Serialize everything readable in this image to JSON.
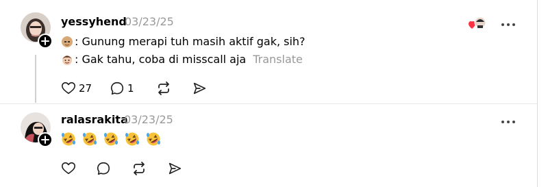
{
  "posts": [
    {
      "username": "yessyhend",
      "date": "03/23/25",
      "lines": [
        {
          "text": ": Gunung merapi tuh masih aktif gak, sih?",
          "emoji": "bald-man-emoji"
        },
        {
          "text": ": Gak tahu, coba di misscall aja",
          "emoji": "smiling-man-emoji"
        }
      ],
      "translate_label": "Translate",
      "like_count": "27",
      "reply_count": "1"
    },
    {
      "username": "ralasrakita",
      "date": "03/23/25",
      "emoji_line": [
        "rofl-emoji",
        "rofl-emoji",
        "rofl-emoji",
        "rofl-emoji",
        "rofl-emoji"
      ]
    }
  ],
  "icons": {
    "like": "heart-icon",
    "reply": "comment-icon",
    "repost": "repost-icon",
    "share": "send-icon",
    "more": "more-icon",
    "follow": "plus-icon"
  },
  "colors": {
    "liked_heart": "#ff3040",
    "muted_text": "#999999"
  }
}
